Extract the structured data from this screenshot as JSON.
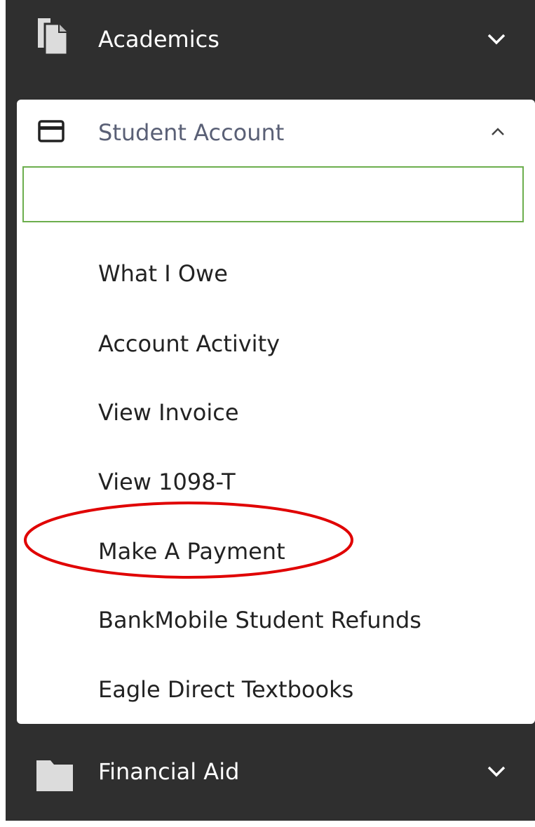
{
  "nav": {
    "academics": {
      "label": "Academics",
      "icon": "documents-icon",
      "chevron": "chevron-down-icon"
    },
    "student_account": {
      "label": "Student Account",
      "icon": "credit-card-icon",
      "chevron": "chevron-up-icon",
      "search_value": "",
      "search_placeholder": "",
      "items": [
        {
          "label": "What I Owe"
        },
        {
          "label": "Account Activity"
        },
        {
          "label": "View Invoice"
        },
        {
          "label": "View 1098-T"
        },
        {
          "label": "Make A Payment"
        },
        {
          "label": "BankMobile Student Refunds"
        },
        {
          "label": "Eagle Direct Textbooks"
        }
      ]
    },
    "financial_aid": {
      "label": "Financial Aid",
      "icon": "folder-icon",
      "chevron": "chevron-down-icon"
    }
  },
  "annotation": {
    "shape": "ellipse",
    "color": "#e00000",
    "target": "Make A Payment"
  },
  "colors": {
    "nav_background": "#2f2f2f",
    "panel_background": "#ffffff",
    "search_border": "#6cae4d",
    "section_label_expanded": "#5a6076",
    "highlight": "#e00000"
  }
}
